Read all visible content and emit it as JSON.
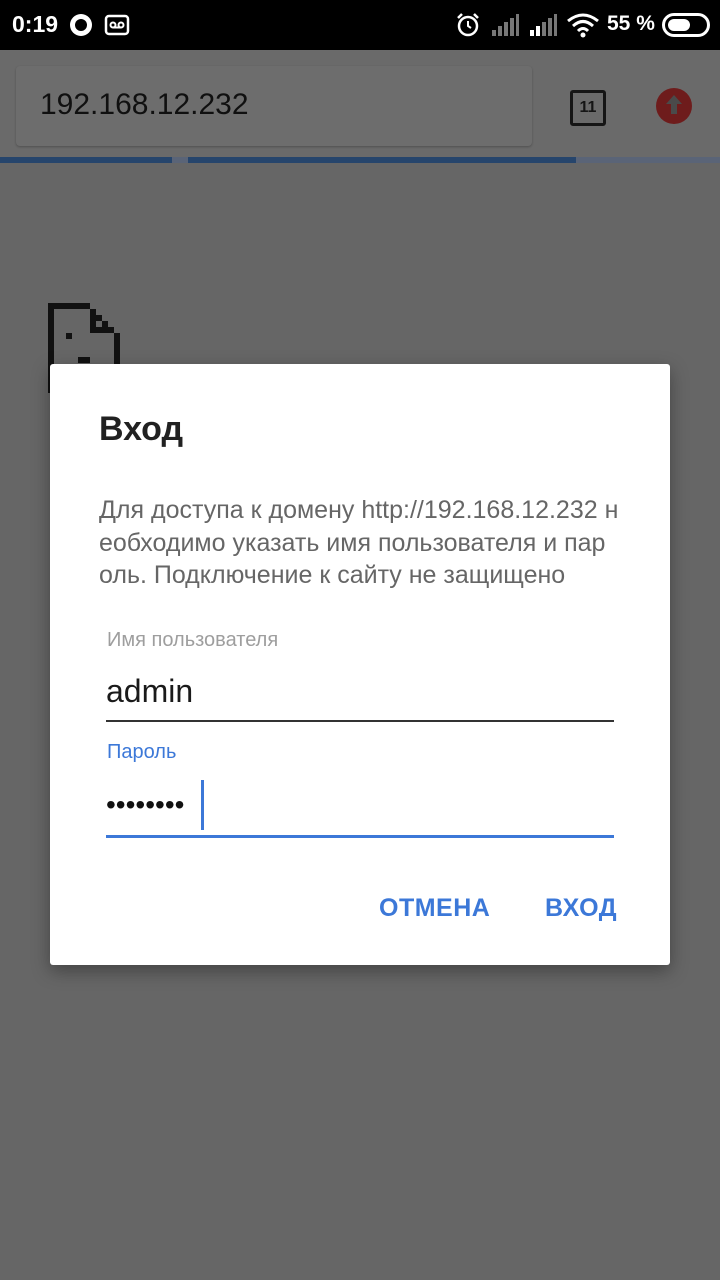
{
  "status_bar": {
    "time": "0:19",
    "battery_percent": "55 %",
    "icons": [
      "message-icon",
      "voicemail-icon",
      "alarm-icon",
      "signal-icon",
      "signal-icon",
      "wifi-icon",
      "battery-icon"
    ]
  },
  "browser": {
    "url": "192.168.12.232",
    "tab_count": "11",
    "icons": [
      "tabs-icon",
      "update-arrow-icon",
      "page-error-icon"
    ],
    "colors": {
      "progress": "#26456c",
      "update": "#6e1c1c"
    }
  },
  "dialog": {
    "title": "Вход",
    "message": "Для доступа к домену http://192.168.12.232 необходимо указать имя пользователя и пароль. Подключение к сайту не защищено",
    "username_label": "Имя пользователя",
    "username_value": "admin",
    "password_label": "Пароль",
    "password_mask": "••••••••",
    "cancel_label": "ОТМЕНА",
    "login_label": "ВХОД",
    "colors": {
      "accent": "#3c78d8"
    }
  }
}
